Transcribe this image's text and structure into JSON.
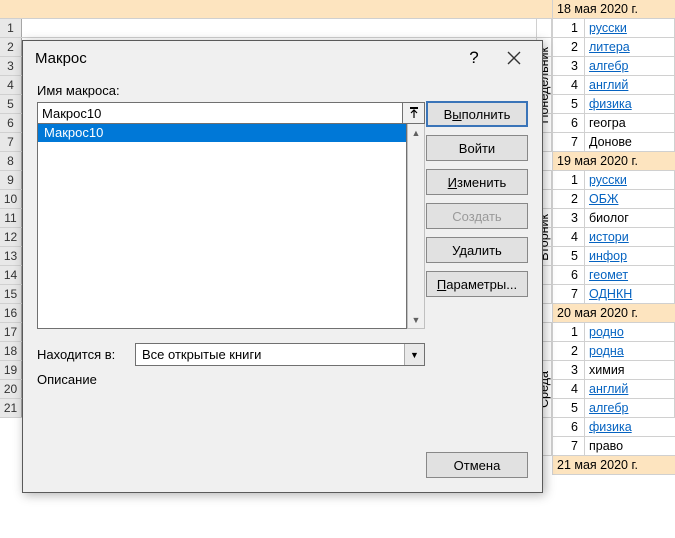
{
  "rows": [
    "1",
    "2",
    "3",
    "4",
    "5",
    "6",
    "7",
    "8",
    "9",
    "10",
    "11",
    "12",
    "13",
    "14",
    "15",
    "16",
    "17",
    "18",
    "19",
    "20",
    "21"
  ],
  "bottom_link": "https://youtu.be/_Ua9Le5a9jM",
  "schedule": {
    "days": [
      {
        "date": "18 мая 2020 г.",
        "vlabel": "Понедельник",
        "items": [
          {
            "n": "1",
            "t": "русски",
            "link": true
          },
          {
            "n": "2",
            "t": "литера",
            "link": true
          },
          {
            "n": "3",
            "t": "алгебр",
            "link": true
          },
          {
            "n": "4",
            "t": "англий",
            "link": true
          },
          {
            "n": "5",
            "t": "физика",
            "link": true
          },
          {
            "n": "6",
            "t": "геогра",
            "link": false
          },
          {
            "n": "7",
            "t": "Донове",
            "link": false
          }
        ]
      },
      {
        "date": "19 мая 2020 г.",
        "vlabel": "Вторник",
        "items": [
          {
            "n": "1",
            "t": "русски",
            "link": true
          },
          {
            "n": "2",
            "t": "ОБЖ",
            "link": true
          },
          {
            "n": "3",
            "t": "биолог",
            "link": false
          },
          {
            "n": "4",
            "t": "истори",
            "link": true
          },
          {
            "n": "5",
            "t": "инфор",
            "link": true
          },
          {
            "n": "6",
            "t": "геомет",
            "link": true
          },
          {
            "n": "7",
            "t": "ОДНКН",
            "link": true
          }
        ]
      },
      {
        "date": "20 мая 2020 г.",
        "vlabel": "Среда",
        "items": [
          {
            "n": "1",
            "t": "родно",
            "link": true
          },
          {
            "n": "2",
            "t": "родна",
            "link": true
          },
          {
            "n": "3",
            "t": "химия",
            "link": false
          },
          {
            "n": "4",
            "t": "англий",
            "link": true
          },
          {
            "n": "5",
            "t": "алгебр",
            "link": true
          },
          {
            "n": "6",
            "t": "физика",
            "link": true
          },
          {
            "n": "7",
            "t": "право",
            "link": false
          }
        ]
      },
      {
        "date": "21 мая 2020 г.",
        "vlabel": "",
        "items": []
      }
    ]
  },
  "dialog": {
    "title": "Макрос",
    "name_label": "Имя макроса:",
    "name_value": "Макрос10",
    "list": [
      "Макрос10"
    ],
    "location_label": "Находится в:",
    "location_value": "Все открытые книги",
    "description_label": "Описание",
    "buttons": {
      "run_pre": "В",
      "run_m": "ы",
      "run_post": "полнить",
      "step": "Войти",
      "edit_pre": "",
      "edit_m": "И",
      "edit_post": "зменить",
      "create": "Создать",
      "delete": "Удалить",
      "options_pre": "",
      "options_m": "П",
      "options_post": "араметры...",
      "cancel": "Отмена"
    }
  }
}
